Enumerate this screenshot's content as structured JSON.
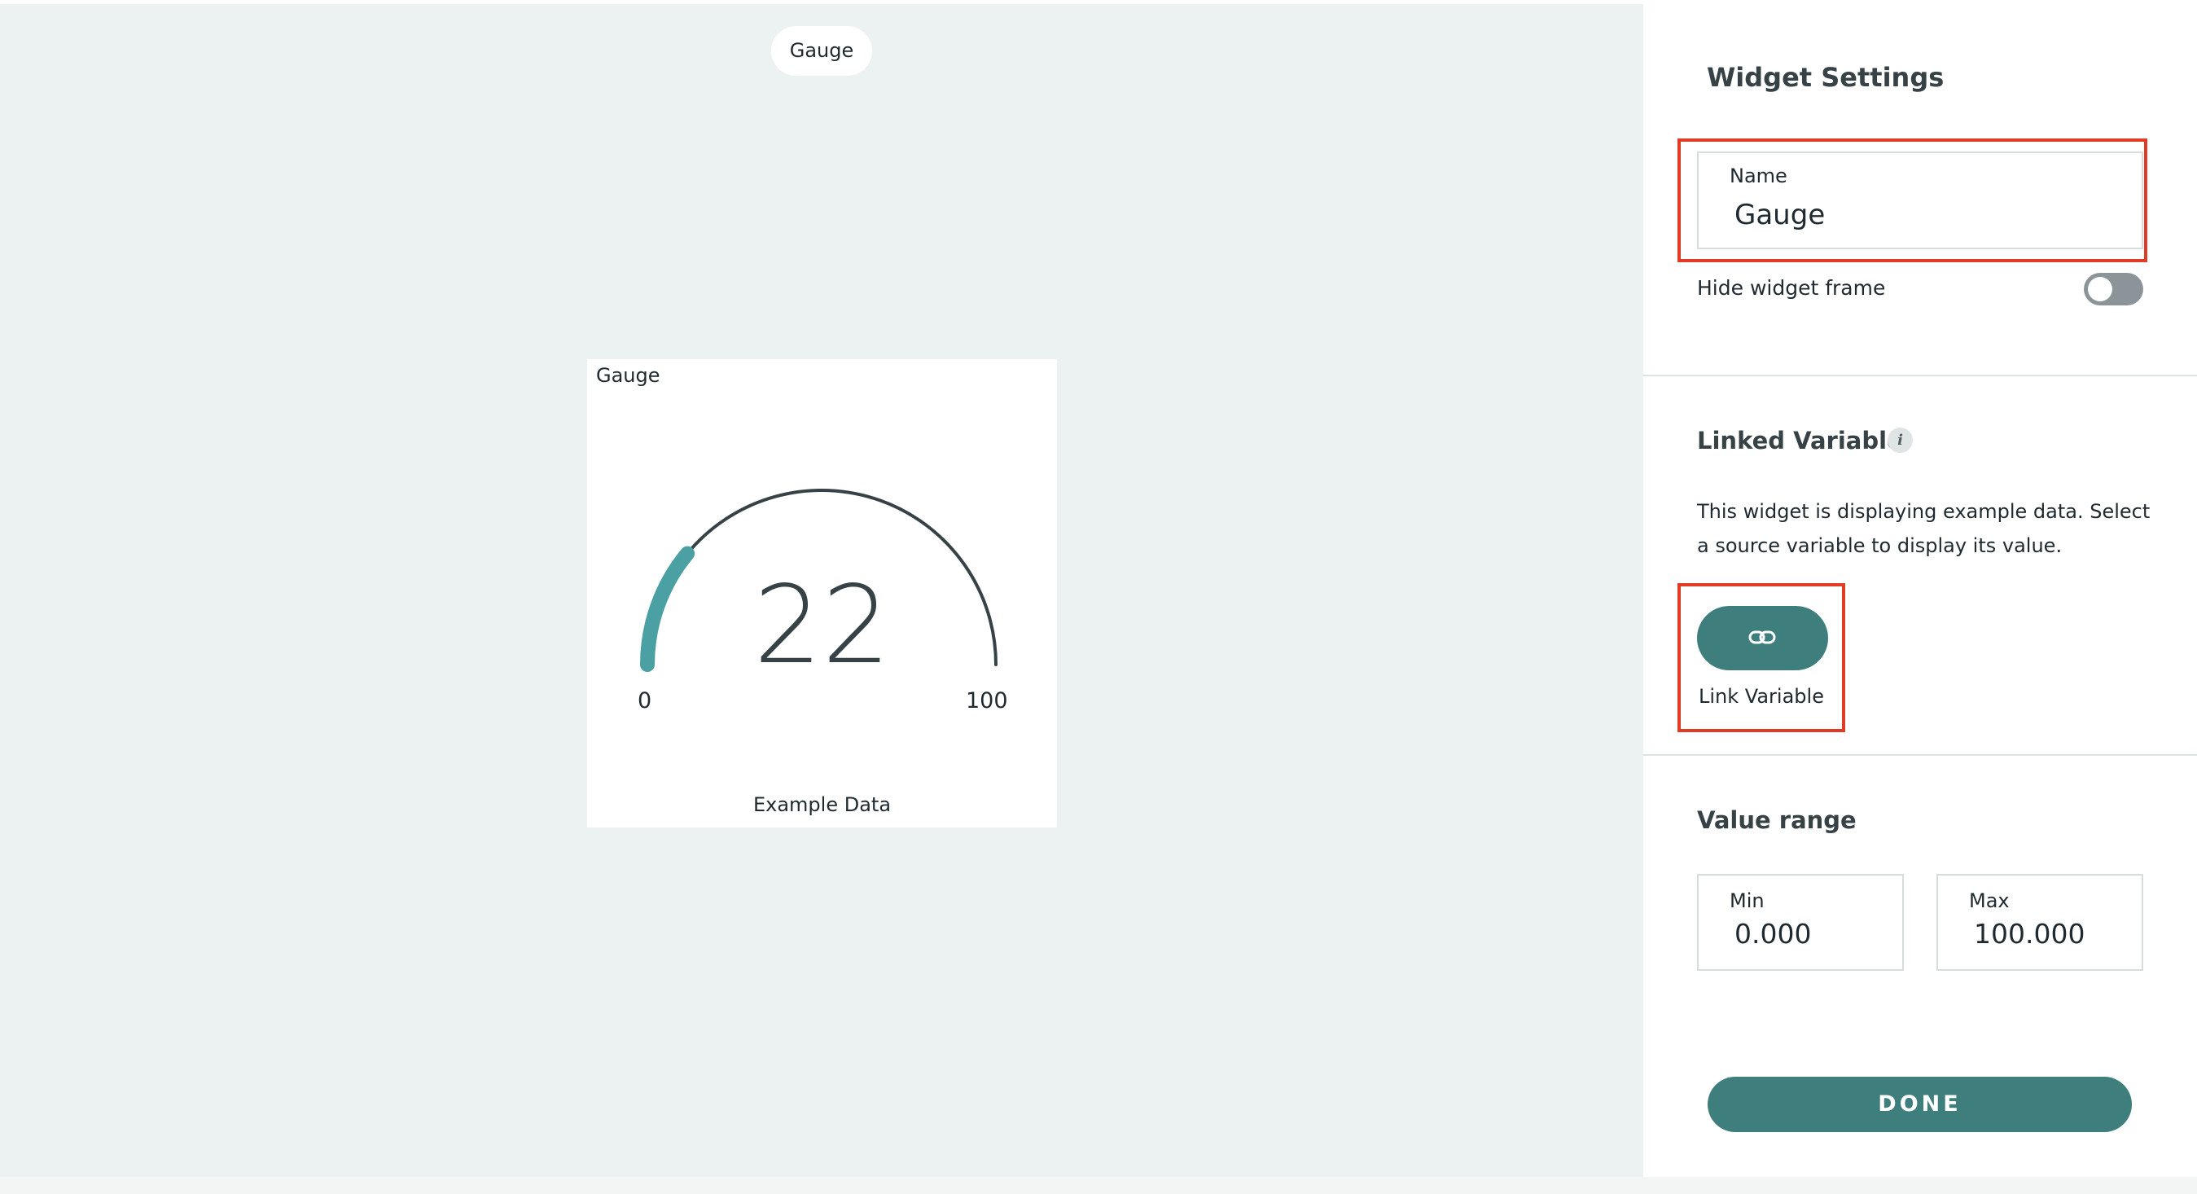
{
  "canvas": {
    "tab_label": "Gauge"
  },
  "widget": {
    "title": "Gauge",
    "value": "22",
    "value_fraction": 0.22,
    "min_label": "0",
    "max_label": "100",
    "caption": "Example Data"
  },
  "settings": {
    "title": "Widget Settings",
    "name_label": "Name",
    "name_value": "Gauge",
    "hide_frame_label": "Hide widget frame",
    "hide_frame_on": false,
    "linked_variable_title": "Linked Variable",
    "linked_variable_description": "This widget is displaying example data. Select a source variable to display its value.",
    "link_button_label": "Link Variable",
    "value_range_title": "Value range",
    "min_label": "Min",
    "min_value": "0.000",
    "max_label": "Max",
    "max_value": "100.000",
    "done_label": "DONE"
  },
  "colors": {
    "accent": "#3e7e7c",
    "gauge_fill": "#4aa0a2",
    "gauge_track": "#374247",
    "highlight": "#e03b24",
    "canvas_bg": "#ecf1f1"
  },
  "icons": {
    "info": "info-icon",
    "link": "link-icon"
  }
}
